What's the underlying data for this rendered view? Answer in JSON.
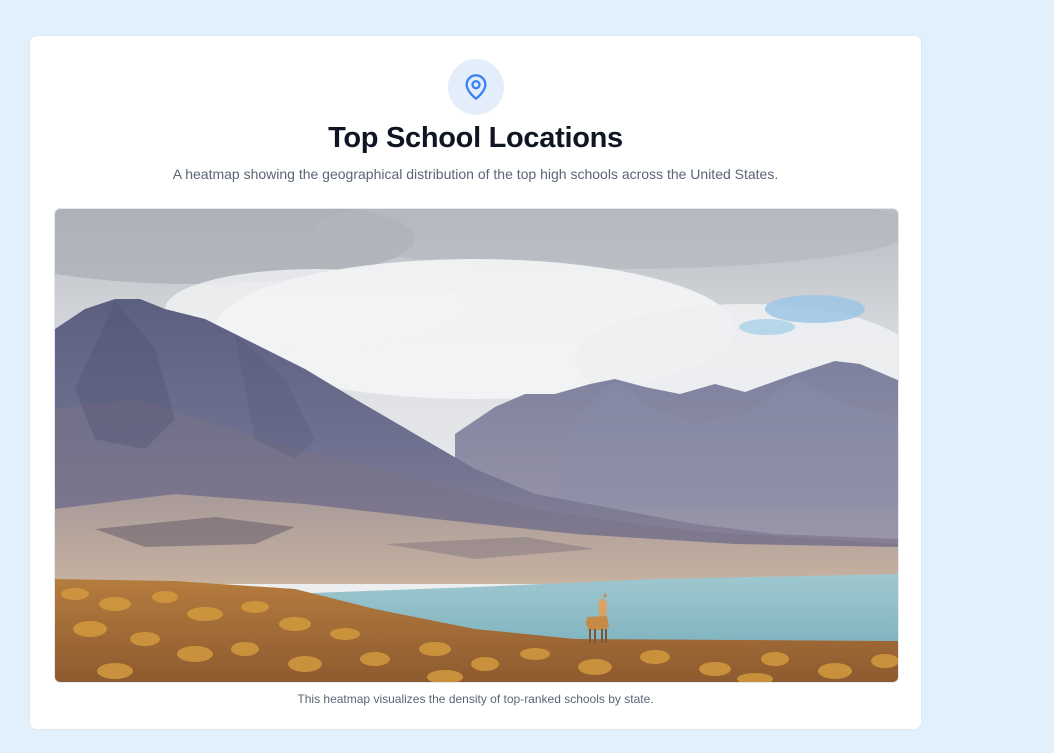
{
  "card": {
    "icon": "map-pin-icon",
    "title": "Top School Locations",
    "subtitle": "A heatmap showing the geographical distribution of the top high schools across the United States.",
    "image_alt": "Photo of mountains with a lake and a vicuña in the foreground",
    "caption": "This heatmap visualizes the density of top-ranked schools by state."
  },
  "colors": {
    "page_background": "#e1f0fb",
    "card_background": "#ffffff",
    "icon_accent": "#3b82f6",
    "title_text": "#0f1523",
    "muted_text": "#5b6576"
  }
}
